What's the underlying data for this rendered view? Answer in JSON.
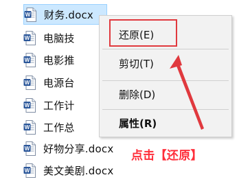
{
  "files": [
    {
      "name": "财务.docx",
      "icon": "word-doc-icon",
      "selected": true
    },
    {
      "name": "电脑技",
      "icon": "word-doc-icon"
    },
    {
      "name": "电影推",
      "icon": "word-doc-icon"
    },
    {
      "name": "电源台",
      "icon": "word-doc-icon"
    },
    {
      "name": "工作计",
      "icon": "word-doc-icon"
    },
    {
      "name": "工作总",
      "icon": "word-doc-icon"
    },
    {
      "name": "好物分享.docx",
      "icon": "word-doc-icon"
    },
    {
      "name": "美文美剧.docx",
      "icon": "word-doc-icon"
    }
  ],
  "context_menu": {
    "restore": "还原(E)",
    "cut": "剪切(T)",
    "delete": "删除(D)",
    "properties": "属性(R)"
  },
  "annotation": {
    "text": "点击【还原】",
    "color": "#ff2e3a"
  },
  "colors": {
    "selected_bg": "#cce8ff",
    "word_blue": "#2b579a",
    "highlight_red": "#e0393e"
  }
}
